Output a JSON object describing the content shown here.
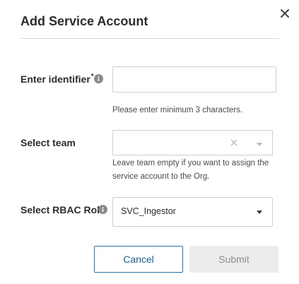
{
  "dialog": {
    "title": "Add Service Account",
    "close_icon": "close-icon"
  },
  "form": {
    "identifier": {
      "label": "Enter identifier",
      "required_mark": "*",
      "value": "",
      "help": "Please enter minimum 3 characters.",
      "info_icon": "info-icon"
    },
    "team": {
      "label": "Select team",
      "value": "",
      "help_line1": "Leave team empty if you want to assign the",
      "help_line2": "service account to the Org.",
      "clear_icon": "clear-icon",
      "dropdown_icon": "chevron-down-icon"
    },
    "rbac_role": {
      "label": "Select RBAC Role",
      "value": "SVC_Ingestor",
      "info_icon": "info-icon",
      "dropdown_icon": "chevron-down-icon"
    }
  },
  "actions": {
    "cancel_label": "Cancel",
    "submit_label": "Submit"
  },
  "colors": {
    "accent": "#2a72a3",
    "disabled_bg": "#ececec",
    "disabled_text": "#8f8f8f"
  }
}
